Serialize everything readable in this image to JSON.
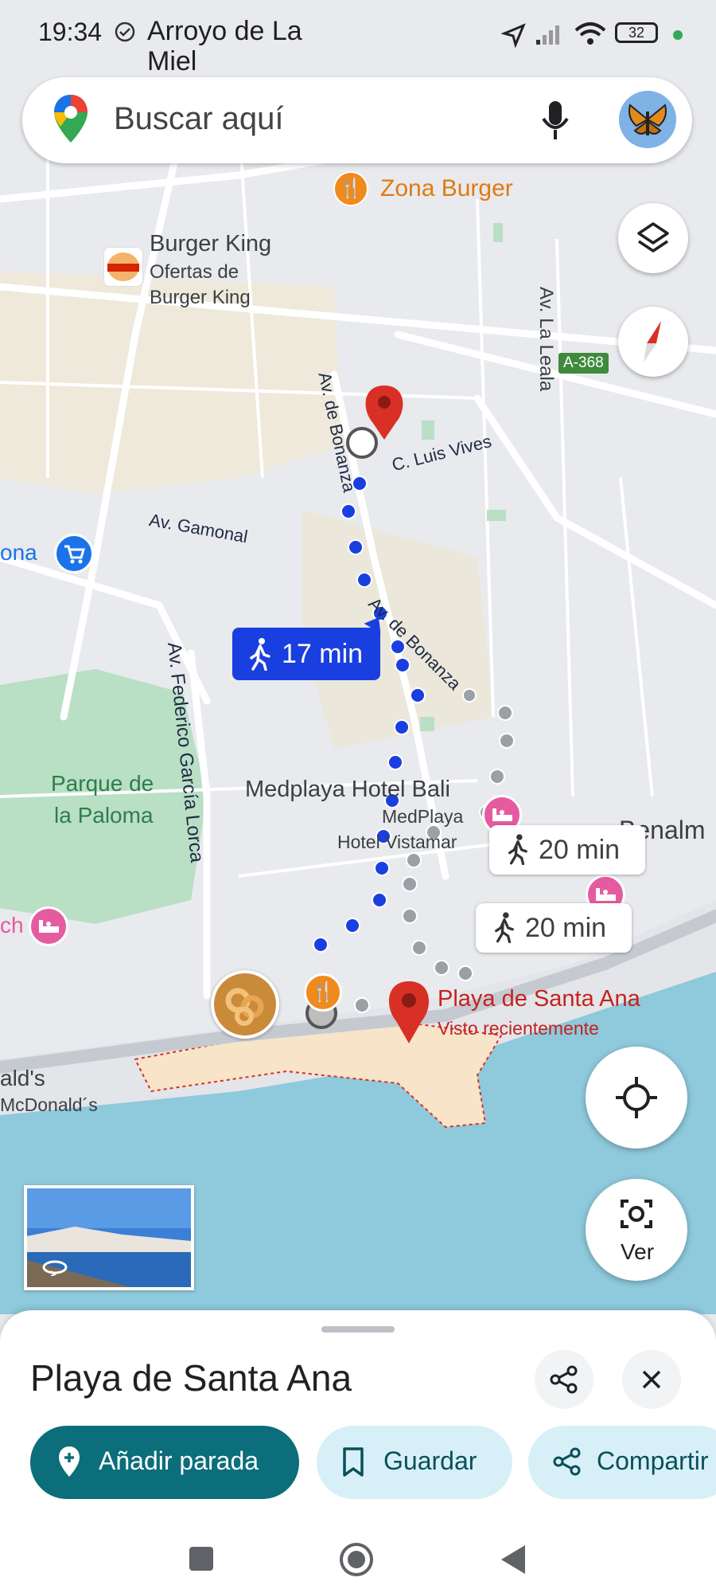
{
  "status_bar": {
    "time": "19:34",
    "location_text": "Arroyo de La Miel",
    "battery": "32"
  },
  "search": {
    "placeholder": "Buscar aquí"
  },
  "map_labels": {
    "zona_burger": "Zona Burger",
    "burger_king": "Burger King",
    "ofertas": "Ofertas de",
    "burger_king_2": "Burger King",
    "av_la_leala": "Av. La Leala",
    "a368": "A-368",
    "av_bonanza_1": "Av. de Bonanza",
    "luis_vives": "C. Luis Vives",
    "av_gamonal": "Av. Gamonal",
    "ona": "ona",
    "av_bonanza_2": "Av. de Bonanza",
    "av_federico": "Av. Federico García Lorca",
    "parque_1": "Parque de",
    "parque_2": "la Paloma",
    "medplaya_bali": "Medplaya Hotel Bali",
    "medplaya": "MedPlaya",
    "hotel_vistamar": "Hotel Vistamar",
    "benalm": "Benalm",
    "ch": "ch",
    "playa_santa_ana": "Playa de Santa Ana",
    "visto": "Visto recientemente",
    "alds": "ald's",
    "mcdonalds": "McDonald´s"
  },
  "route_times": {
    "primary": "17 min",
    "alt1": "20 min",
    "alt2": "20 min"
  },
  "controls": {
    "ver_label": "Ver"
  },
  "sheet": {
    "title": "Playa de Santa Ana",
    "chips": {
      "add_stop": "Añadir parada",
      "save": "Guardar",
      "share": "Compartir"
    }
  },
  "colors": {
    "route_blue": "#1a3fe0",
    "route_gray": "#9aa0a6",
    "pin_red": "#d93025",
    "teal": "#0b6e7a",
    "chip_light": "#d7f0f8",
    "water": "#8ec9dc",
    "park": "#b9dfc4",
    "beach": "#f8e4c8"
  }
}
